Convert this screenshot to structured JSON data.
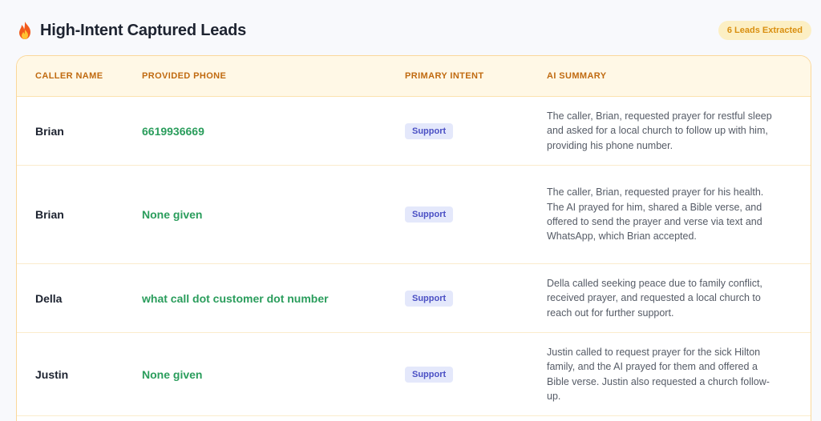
{
  "header": {
    "title": "High-Intent Captured Leads",
    "badge": "6 Leads Extracted",
    "icon": "fire-icon"
  },
  "table": {
    "columns": {
      "name": "CALLER NAME",
      "phone": "PROVIDED PHONE",
      "intent": "PRIMARY INTENT",
      "summary": "AI SUMMARY"
    },
    "rows": [
      {
        "name": "Brian",
        "phone": "6619936669",
        "intent": "Support",
        "summary": "The caller, Brian, requested prayer for restful sleep and asked for a local church to follow up with him, providing his phone number."
      },
      {
        "name": "Brian",
        "phone": "None given",
        "intent": "Support",
        "summary": "The caller, Brian, requested prayer for his health. The AI prayed for him, shared a Bible verse, and offered to send the prayer and verse via text and WhatsApp, which Brian accepted."
      },
      {
        "name": "Della",
        "phone": "what call dot customer dot number",
        "intent": "Support",
        "summary": "Della called seeking peace due to family conflict, received prayer, and requested a local church to reach out for further support."
      },
      {
        "name": "Justin",
        "phone": "None given",
        "intent": "Support",
        "summary": "Justin called to request prayer for the sick Hilton family, and the AI prayed for them and offered a Bible verse. Justin also requested a church follow-up."
      }
    ]
  },
  "colors": {
    "accent_header_text": "#c06a10",
    "phone_green": "#2a9d5c",
    "intent_badge_bg": "#e4e8fb",
    "intent_badge_text": "#4a4fc4",
    "card_border": "#fbd89a",
    "count_badge_bg": "#fcefc4"
  }
}
